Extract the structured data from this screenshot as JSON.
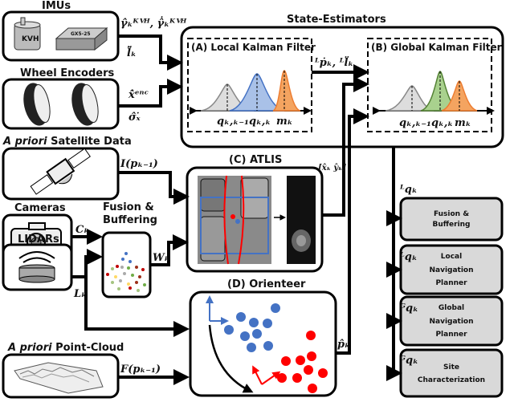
{
  "sources": {
    "imus": {
      "title": "IMUs",
      "kvh_label": "KVH",
      "gx5_label": "GX5-25"
    },
    "wheel_encoders": {
      "title": "Wheel Encoders"
    },
    "satellite": {
      "title_italic": "A priori",
      "title_rest": " Satellite Data"
    },
    "cameras": {
      "title": "Cameras"
    },
    "lidars": {
      "title": "LIDARs"
    },
    "point_cloud": {
      "title_italic": "A priori",
      "title_rest": " Point-Cloud"
    }
  },
  "signals": {
    "imu_gamma": "γ̂ₖᴷⱽᴴ, γ̂̇ₖᴷⱽᴴ",
    "imu_l": "l̂̈ₖ",
    "enc_x": "x̂̇ᵉⁿᶜ",
    "enc_sigma": "σ̂ₓ̇",
    "satellite": "I(pₖ₋₁)",
    "cameras": "Cₖ",
    "lidars": "Lₖ",
    "fusion_out": "Wₖ",
    "point_cloud": "F(pₖ₋₁)",
    "local_to_global": "ᴸṗₖ, ᴸl̈ₖ",
    "atlis_out": "[x̂ₖ ŷₖ]",
    "orienteer_out": "p̂ₖ",
    "out_fusion": "ᴸqₖ",
    "out_local": "ᴸqₖ",
    "out_global": "ᴳqₖ",
    "out_site": "ᴳqₖ"
  },
  "state_estimators": {
    "title": "State-Estimators",
    "local_kf": {
      "title": "(A) Local Kalman Filter",
      "labels": [
        "qₖ,ₖ₋₁",
        "qₖ,ₖ",
        "mₖ"
      ]
    },
    "global_kf": {
      "title": "(B) Global Kalman Filter",
      "labels": [
        "qₖ,ₖ₋₁",
        "qₖ,ₖ",
        "mₖ"
      ]
    }
  },
  "fusion": {
    "title_line1": "Fusion &",
    "title_line2": "Buffering"
  },
  "atlis": {
    "title": "(C) ATLIS"
  },
  "orienteer": {
    "title": "(D) Orienteer"
  },
  "outputs": [
    {
      "line1": "Fusion &",
      "line2": "Buffering",
      "line3": ""
    },
    {
      "line1": "Local",
      "line2": "Navigation",
      "line3": "Planner"
    },
    {
      "line1": "Global",
      "line2": "Navigation",
      "line3": "Planner"
    },
    {
      "line1": "Site",
      "line2": "Characterization",
      "line3": ""
    }
  ],
  "colors": {
    "prior": "#bfbfbf",
    "local": "#4472c4",
    "global": "#70ad47",
    "measurement": "#ed7d31",
    "red": "#ff0000"
  }
}
